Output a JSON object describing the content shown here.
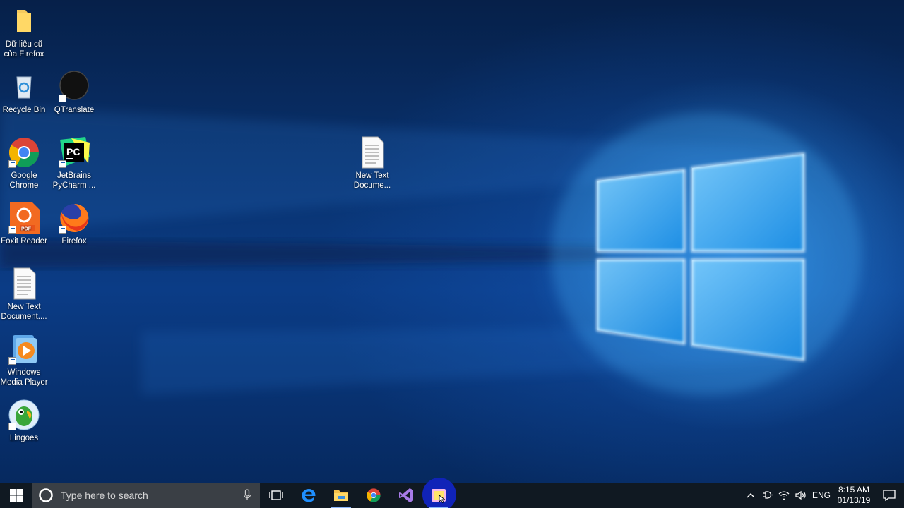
{
  "desktop": {
    "icons": [
      {
        "label": "Dữ liệu cũ của Firefox",
        "line1": "Dữ liệu cũ",
        "line2": "của Firefox",
        "icon": "folder-icon"
      },
      {
        "label": "Recycle Bin",
        "line1": "Recycle Bin",
        "line2": "",
        "icon": "recycle-bin-icon"
      },
      {
        "label": "QTranslate",
        "line1": "QTranslate",
        "line2": "",
        "icon": "qtranslate-icon"
      },
      {
        "label": "Google Chrome",
        "line1": "Google",
        "line2": "Chrome",
        "icon": "chrome-icon"
      },
      {
        "label": "JetBrains PyCharm ...",
        "line1": "JetBrains",
        "line2": "PyCharm ...",
        "icon": "pycharm-icon"
      },
      {
        "label": "Foxit Reader",
        "line1": "Foxit Reader",
        "line2": "",
        "icon": "foxit-reader-icon"
      },
      {
        "label": "Firefox",
        "line1": "Firefox",
        "line2": "",
        "icon": "firefox-icon"
      },
      {
        "label": "New Text Document....",
        "line1": "New Text",
        "line2": "Document....",
        "icon": "text-document-icon"
      },
      {
        "label": "Windows Media Player",
        "line1": "Windows",
        "line2": "Media Player",
        "icon": "media-player-icon"
      },
      {
        "label": "Lingoes",
        "line1": "Lingoes",
        "line2": "",
        "icon": "lingoes-icon"
      },
      {
        "label": "New Text Docume...",
        "line1": "New Text",
        "line2": "Docume...",
        "icon": "text-document-icon"
      }
    ]
  },
  "taskbar": {
    "search_placeholder": "Type here to search",
    "pinned": [
      "task-view-icon",
      "edge-icon",
      "file-explorer-icon",
      "chrome-icon",
      "visual-studio-icon",
      "sticky-app-icon"
    ],
    "tray": {
      "language": "ENG",
      "time": "8:15 AM",
      "date": "01/13/19"
    }
  },
  "colors": {
    "taskbar": "#101922",
    "search_box": "#3a3f45",
    "wallpaper_glow": "#3aaaff",
    "highlight_circle": "#1023b8"
  }
}
